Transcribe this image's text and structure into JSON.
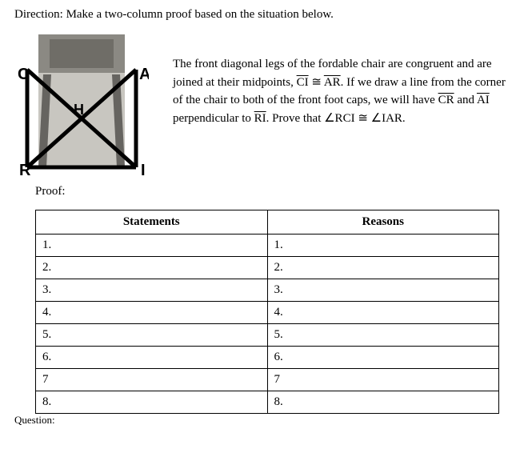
{
  "direction": "Direction: Make a two-column proof based on the situation below.",
  "labels": {
    "C": "C",
    "A": "A",
    "H": "H",
    "R": "R",
    "I": "I"
  },
  "description": {
    "p1a": "The front diagonal legs of the fordable chair are congruent and are joined at their midpoints, ",
    "seg1": "CI",
    "p1b": " ≅ ",
    "seg2": "AR",
    "p1c": ". If we draw a line from the corner of the chair to both of the front foot caps, we will have ",
    "seg3": "CR",
    "p1d": " and ",
    "seg4": "AI",
    "p1e": "  perpendicular to ",
    "seg5": "RI",
    "p1f": ". Prove that ∠RCI ≅ ∠IAR."
  },
  "proof_label": "Proof:",
  "table": {
    "h1": "Statements",
    "h2": "Reasons",
    "rows": [
      "1.",
      "2.",
      "3.",
      "4.",
      "5.",
      "6.",
      "7",
      "8."
    ]
  },
  "bottom": "Question:"
}
